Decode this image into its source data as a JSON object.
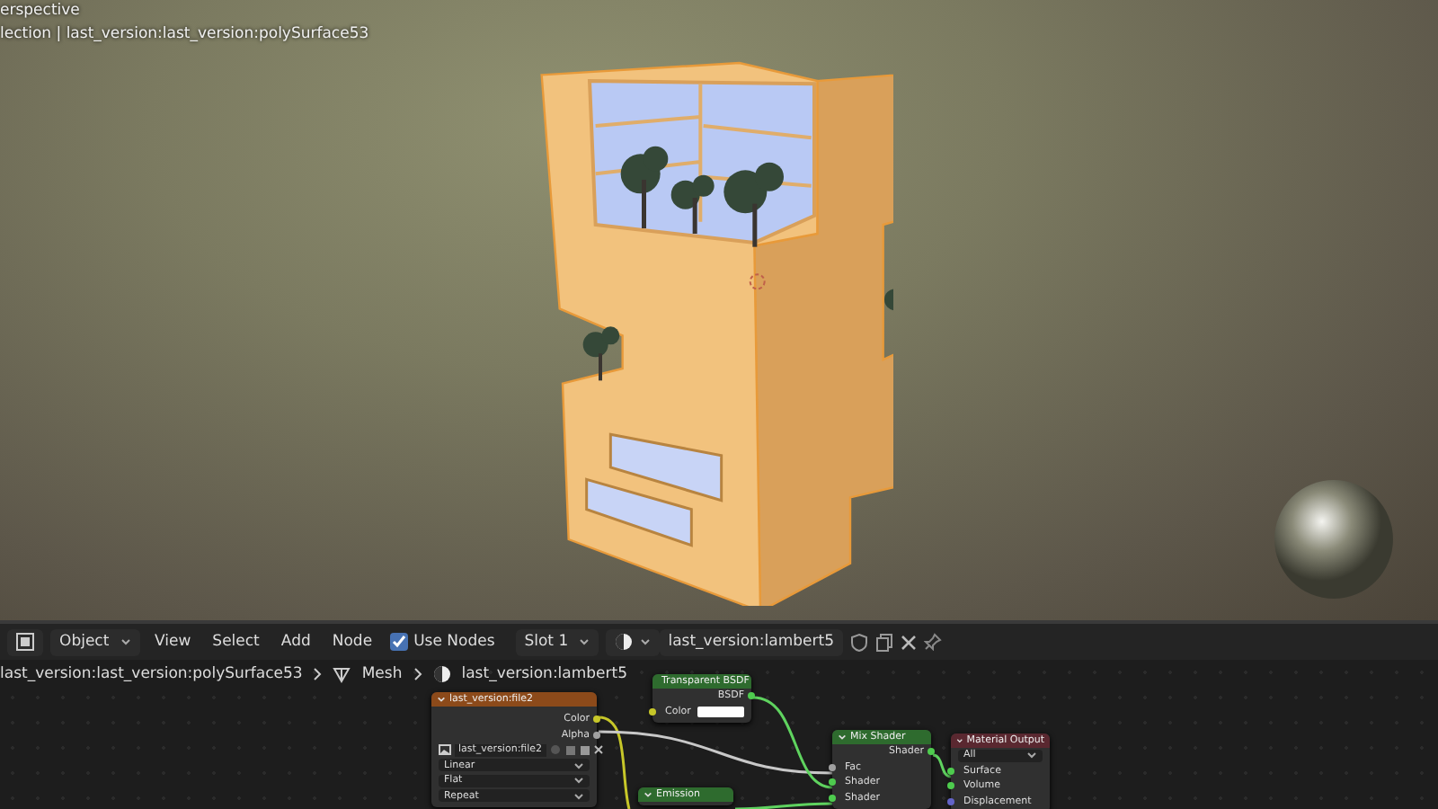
{
  "viewport": {
    "view_name": "erspective",
    "collection_info": "lection | last_version:last_version:polySurface53"
  },
  "header": {
    "mode": "Object",
    "menus": [
      "View",
      "Select",
      "Add",
      "Node"
    ],
    "use_nodes": {
      "label": "Use Nodes",
      "checked": true
    },
    "slot": "Slot 1",
    "material": "last_version:lambert5"
  },
  "breadcrumb": [
    {
      "kind": "object",
      "label": "last_version:last_version:polySurface53"
    },
    {
      "kind": "mesh",
      "label": "Mesh"
    },
    {
      "kind": "material",
      "label": "last_version:lambert5"
    }
  ],
  "nodes": [
    {
      "title": "last_version:file2",
      "color": "#8c4a1a",
      "rows": [
        {
          "kind": "output",
          "label": "Color",
          "color": "#c7c729"
        },
        {
          "kind": "output",
          "label": "Alpha",
          "color": "#a1a1a1"
        },
        {
          "kind": "image-field",
          "value": "last_version:file2"
        },
        {
          "kind": "dropdown",
          "value": "Linear"
        },
        {
          "kind": "dropdown",
          "value": "Flat"
        },
        {
          "kind": "dropdown",
          "value": "Repeat"
        }
      ]
    },
    {
      "title": "Transparent BSDF",
      "color": "#2e6b2e",
      "rows": [
        {
          "kind": "output",
          "label": "BSDF",
          "color": "#4ecc4e"
        },
        {
          "kind": "color-input",
          "label": "Color",
          "color": "#c7c729"
        }
      ]
    },
    {
      "title": "Emission",
      "color": "#2e6b2e"
    },
    {
      "title": "Mix Shader",
      "color": "#2e6b2e",
      "rows": [
        {
          "kind": "output",
          "label": "Shader",
          "color": "#4ecc4e"
        },
        {
          "kind": "input",
          "label": "Fac",
          "color": "#a1a1a1"
        },
        {
          "kind": "input",
          "label": "Shader",
          "color": "#4ecc4e"
        },
        {
          "kind": "input",
          "label": "Shader",
          "color": "#4ecc4e"
        }
      ]
    },
    {
      "title": "Material Output",
      "color": "#5a2830",
      "rows": [
        {
          "kind": "dropdown",
          "value": "All"
        },
        {
          "kind": "input",
          "label": "Surface",
          "color": "#4ecc4e"
        },
        {
          "kind": "input",
          "label": "Volume",
          "color": "#4ecc4e"
        },
        {
          "kind": "input",
          "label": "Displacement",
          "color": "#6363c7"
        }
      ]
    }
  ]
}
